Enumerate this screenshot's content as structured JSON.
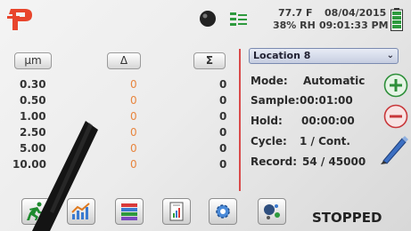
{
  "header": {
    "temperature": "77.7 F",
    "humidity": "38% RH",
    "date": "08/04/2015",
    "time": "09:01:33 PM",
    "logo_icon": "P-logo-icon",
    "sensor_icon": "sensor-icon",
    "signal_icon": "signal-icon",
    "battery_icon": "battery-icon",
    "brand_color": "#e8452c"
  },
  "columns": {
    "unit": "µm",
    "delta": "Δ",
    "sum": "Σ"
  },
  "rows": [
    {
      "size": "0.30",
      "delta": "0",
      "sum": "0"
    },
    {
      "size": "0.50",
      "delta": "0",
      "sum": "0"
    },
    {
      "size": "1.00",
      "delta": "0",
      "sum": "0"
    },
    {
      "size": "2.50",
      "delta": "0",
      "sum": "0"
    },
    {
      "size": "5.00",
      "delta": "0",
      "sum": "0"
    },
    {
      "size": "10.00",
      "delta": "0",
      "sum": "0"
    }
  ],
  "location": {
    "selected": "Location 8"
  },
  "info": {
    "mode_label": "Mode:",
    "mode_value": "Automatic",
    "sample_label": "Sample:",
    "sample_value": "00:01:00",
    "hold_label": "Hold:",
    "hold_value": "00:00:00",
    "cycle_label": "Cycle:",
    "cycle_value": "1 / Cont.",
    "record_label": "Record:",
    "record_value": "54 / 45000"
  },
  "status": "STOPPED",
  "toolbar_icons": [
    "run-icon",
    "chart-icon",
    "layers-icon",
    "report-icon",
    "settings-icon",
    "tools-icon"
  ]
}
